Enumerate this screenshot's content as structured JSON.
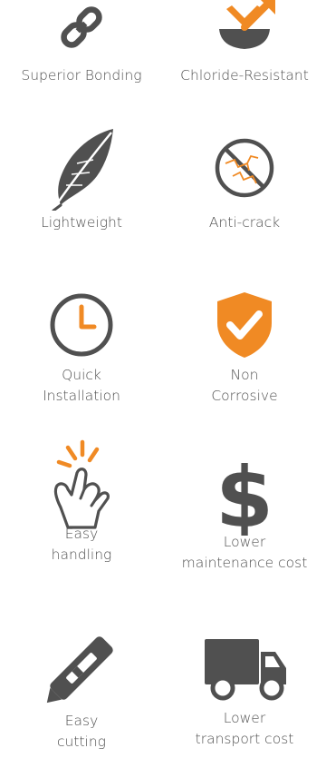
{
  "colors": {
    "accent": "#f08a24",
    "icon_gray": "#505050"
  },
  "features": [
    {
      "id": "superior-bonding",
      "icon": "link-icon",
      "lines": [
        "Superior Bonding"
      ]
    },
    {
      "id": "chloride-resistant",
      "icon": "chloride-resistant-icon",
      "lines": [
        "Chloride-Resistant"
      ]
    },
    {
      "id": "lightweight",
      "icon": "feather-icon",
      "lines": [
        "Lightweight"
      ]
    },
    {
      "id": "anti-crack",
      "icon": "anti-crack-icon",
      "lines": [
        "Anti-crack"
      ]
    },
    {
      "id": "quick-installation",
      "icon": "clock-icon",
      "lines": [
        "Quick",
        "Installation"
      ]
    },
    {
      "id": "non-corrosive",
      "icon": "shield-check-icon",
      "lines": [
        "Non",
        "Corrosive"
      ]
    },
    {
      "id": "easy-handling",
      "icon": "hand-snap-icon",
      "lines": [
        "Easy",
        "handling"
      ]
    },
    {
      "id": "lower-maintenance-cost",
      "icon": "dollar-icon",
      "lines": [
        "Lower",
        "maintenance cost"
      ]
    },
    {
      "id": "easy-cutting",
      "icon": "utility-knife-icon",
      "lines": [
        "Easy",
        "cutting"
      ]
    },
    {
      "id": "lower-transport-cost",
      "icon": "truck-icon",
      "lines": [
        "Lower",
        "transport cost"
      ]
    }
  ]
}
